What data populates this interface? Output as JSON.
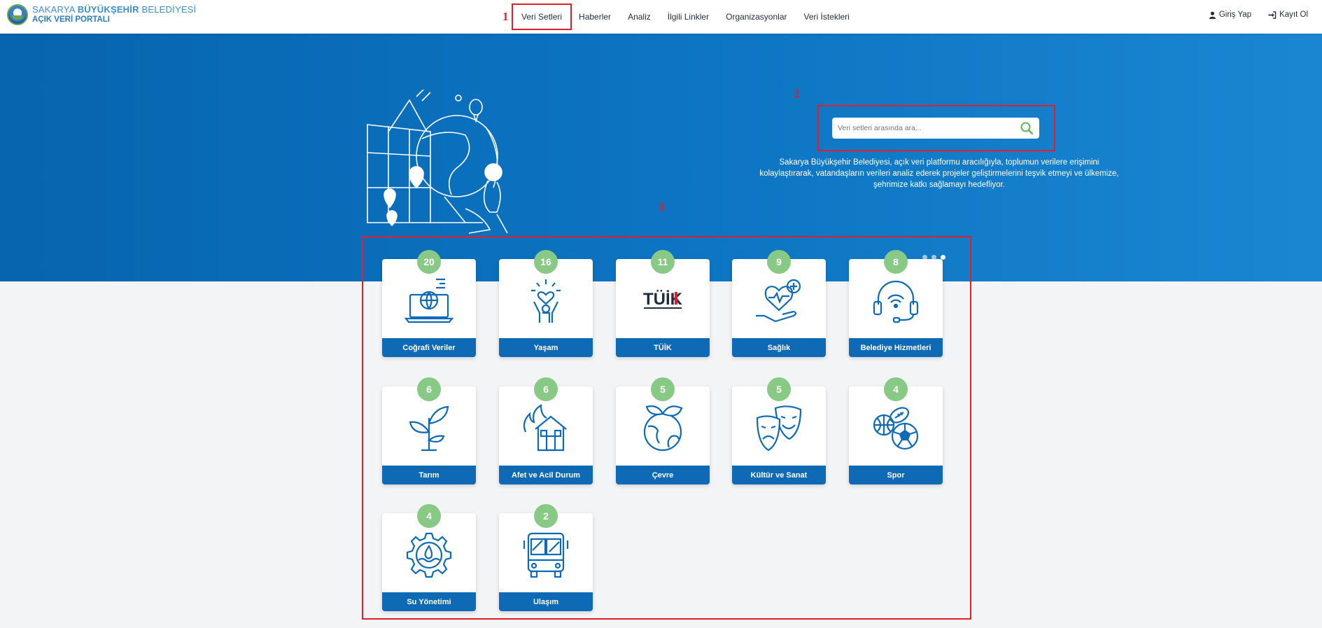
{
  "header": {
    "logo_line1_prefix": "SAKARYA ",
    "logo_line1_bold": "BÜYÜKŞEHİR",
    "logo_line1_suffix": " BELEDİYESİ",
    "logo_line2": "AÇIK VERİ PORTALI",
    "nav": [
      {
        "label": "Veri Setleri"
      },
      {
        "label": "Haberler"
      },
      {
        "label": "Analiz"
      },
      {
        "label": "İlgili Linkler"
      },
      {
        "label": "Organizasyonlar"
      },
      {
        "label": "Veri İstekleri"
      }
    ],
    "login_label": "Giriş Yap",
    "register_label": "Kayıt Ol"
  },
  "annotations": [
    "1",
    "2",
    "3"
  ],
  "hero": {
    "search_placeholder": "Veri setleri arasında ara...",
    "text_line1": "Sakarya Büyükşehir Belediyesi, açık veri platformu aracılığıyla, toplumun verilere erişimini",
    "text_line2": "kolaylaştırarak, vatandaşların verileri analiz ederek projeler geliştirmelerini teşvik etmeyi ve ülkemize,",
    "text_line3": "şehrimize katkı sağlamayı hedefliyor.",
    "slide_count": 3,
    "active_slide": 3
  },
  "categories": [
    {
      "label": "Coğrafi Veriler",
      "count": "20",
      "icon": "laptop-globe-icon"
    },
    {
      "label": "Yaşam",
      "count": "16",
      "icon": "person-heart-icon"
    },
    {
      "label": "TÜİK",
      "count": "11",
      "icon": "tuik-logo-icon"
    },
    {
      "label": "Sağlık",
      "count": "9",
      "icon": "hand-heart-icon"
    },
    {
      "label": "Belediye Hizmetleri",
      "count": "8",
      "icon": "headset-icon"
    },
    {
      "label": "Tarım",
      "count": "6",
      "icon": "sprout-icon"
    },
    {
      "label": "Afet ve Acil Durum",
      "count": "6",
      "icon": "house-fire-icon"
    },
    {
      "label": "Çevre",
      "count": "5",
      "icon": "globe-leaves-icon"
    },
    {
      "label": "Kültür ve Sanat",
      "count": "5",
      "icon": "theater-masks-icon"
    },
    {
      "label": "Spor",
      "count": "4",
      "icon": "sport-balls-icon"
    },
    {
      "label": "Su Yönetimi",
      "count": "4",
      "icon": "gear-water-icon"
    },
    {
      "label": "Ulaşım",
      "count": "2",
      "icon": "bus-icon"
    }
  ],
  "colors": {
    "accent": "#0e6ab4",
    "badge": "#88c985",
    "hero": "#0c74c2",
    "annotation": "#e31e24"
  },
  "tuik_logo_text": "TÜİK"
}
